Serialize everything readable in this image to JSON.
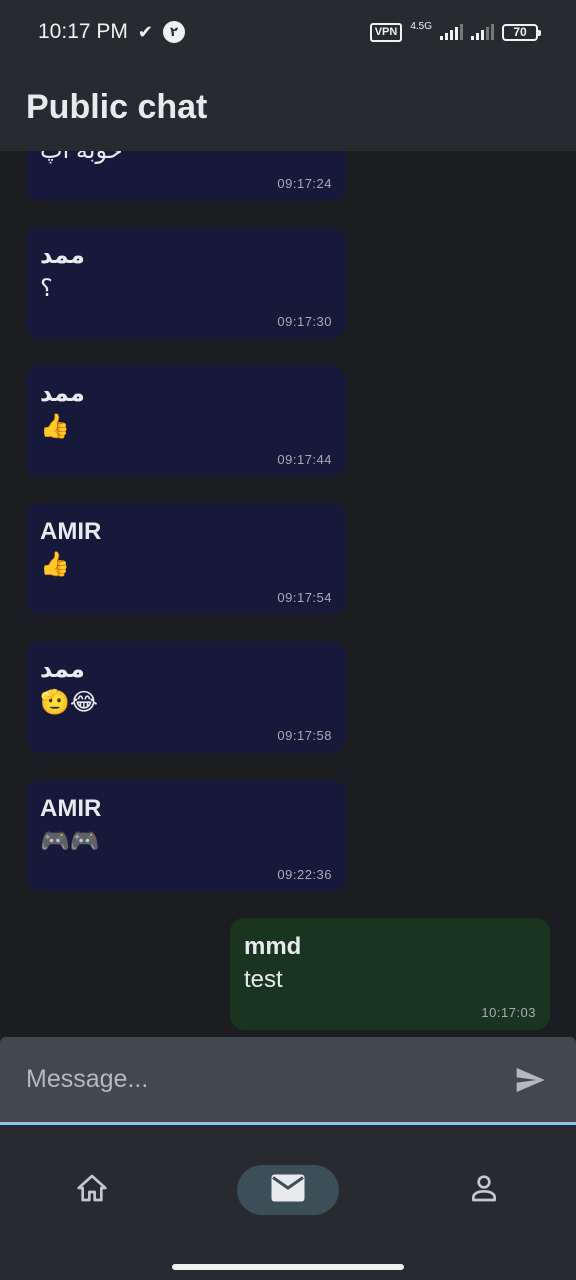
{
  "status_bar": {
    "time": "10:17 PM",
    "check_mark": "✔",
    "notification_badge": "۲",
    "vpn": "VPN",
    "network": "4.5G",
    "battery": "70"
  },
  "app_bar": {
    "title": "Public chat"
  },
  "messages": [
    {
      "sender": "",
      "text": "خوبه اپ",
      "time": "09:17:24"
    },
    {
      "sender": "ممد",
      "text": "؟",
      "time": "09:17:30"
    },
    {
      "sender": "ممد",
      "text": "👍",
      "time": "09:17:44"
    },
    {
      "sender": "AMIR",
      "text": "👍",
      "time": "09:17:54"
    },
    {
      "sender": "ممد",
      "text": "🫡😂",
      "time": "09:17:58"
    },
    {
      "sender": "AMIR",
      "text": "🎮🎮",
      "time": "09:22:36"
    },
    {
      "sender": "mmd",
      "text": "test",
      "time": "10:17:03"
    }
  ],
  "input": {
    "placeholder": "Message..."
  },
  "bottom_nav": {
    "items": [
      "home-icon",
      "mail-icon",
      "person-icon"
    ],
    "active": "mail-icon"
  },
  "colors": {
    "incoming_bubble": "#16193a",
    "outgoing_bubble": "#193520",
    "accent": "#8cc4e8"
  }
}
